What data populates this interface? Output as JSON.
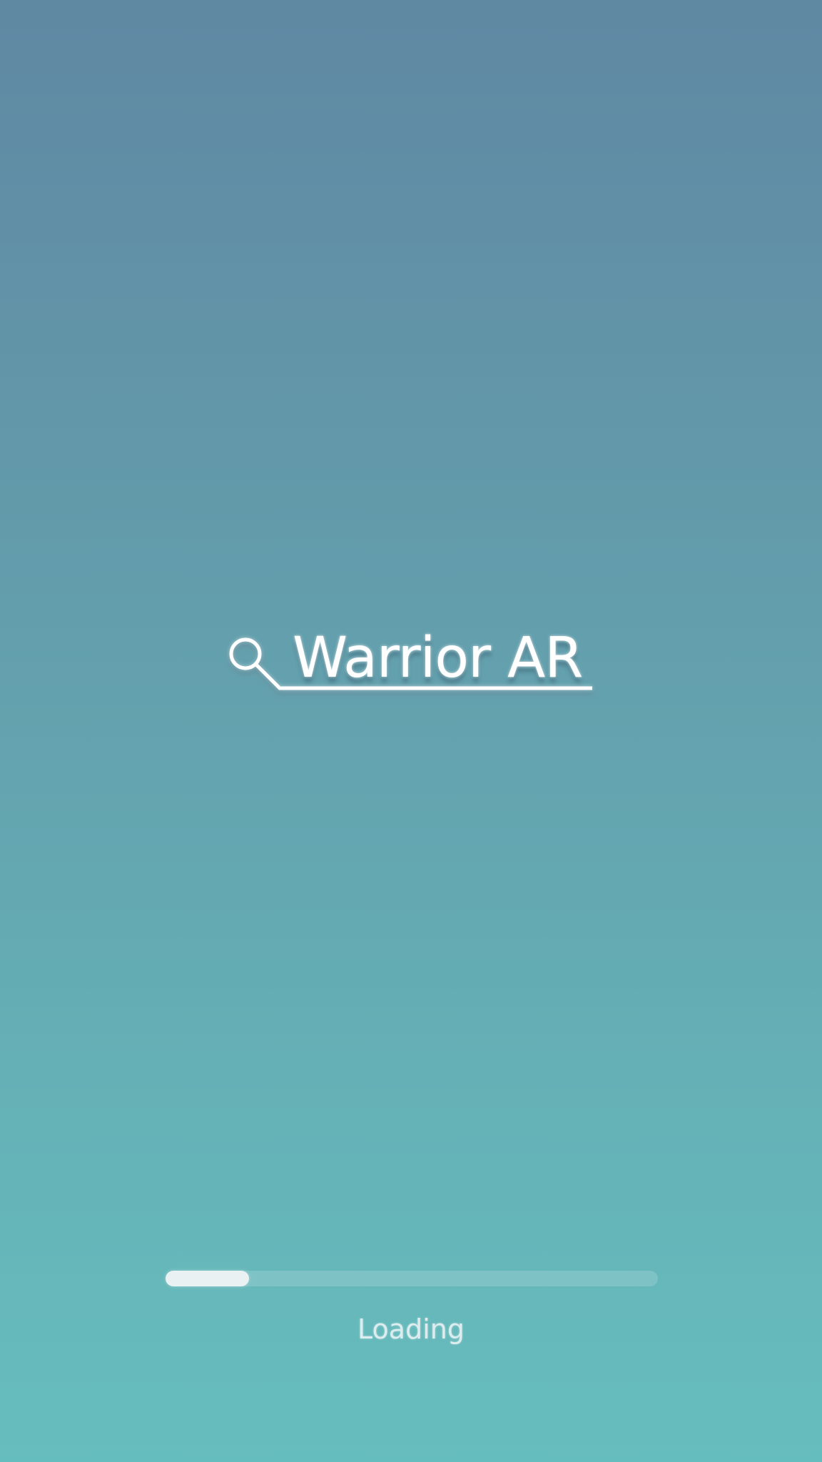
{
  "app": {
    "title": "Warrior AR",
    "logo_icon": "magnifier-icon"
  },
  "loading": {
    "label": "Loading",
    "progress": 0.17
  },
  "colors": {
    "background_top": "#5f88a3",
    "background_bottom": "#66bdbd",
    "progress_fill": "#e9f1f3",
    "text": "#ffffff"
  }
}
